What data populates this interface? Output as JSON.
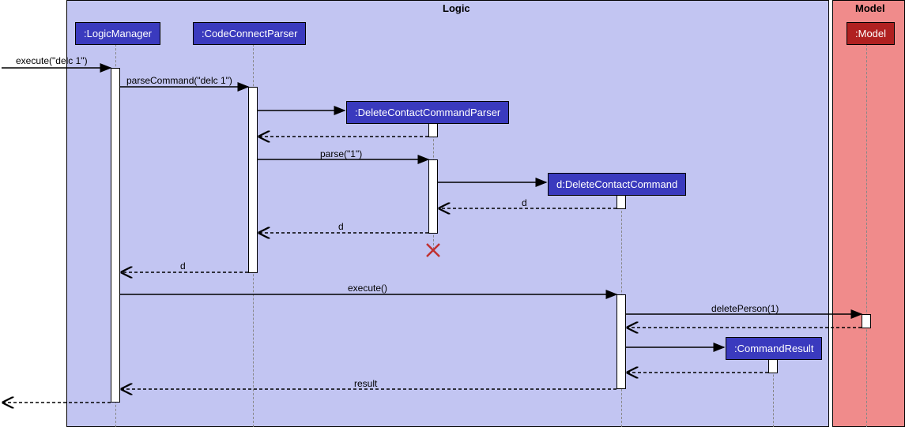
{
  "frames": {
    "logic": "Logic",
    "model": "Model"
  },
  "participants": {
    "logicManager": ":LogicManager",
    "codeConnectParser": ":CodeConnectParser",
    "deleteContactCommandParser": ":DeleteContactCommandParser",
    "deleteContactCommand": "d:DeleteContactCommand",
    "model": ":Model",
    "commandResult": ":CommandResult"
  },
  "messages": {
    "execute1": "execute(\"delc 1\")",
    "parseCommand": "parseCommand(\"delc 1\")",
    "parse": "parse(\"1\")",
    "d1": "d",
    "d2": "d",
    "d3": "d",
    "execute2": "execute()",
    "deletePerson": "deletePerson(1)",
    "result": "result"
  },
  "chart_data": {
    "type": "sequence-diagram",
    "frames": [
      {
        "name": "Logic",
        "participants": [
          ":LogicManager",
          ":CodeConnectParser",
          ":DeleteContactCommandParser",
          "d:DeleteContactCommand",
          ":CommandResult"
        ]
      },
      {
        "name": "Model",
        "participants": [
          ":Model"
        ]
      }
    ],
    "interactions": [
      {
        "from": "external",
        "to": ":LogicManager",
        "message": "execute(\"delc 1\")",
        "type": "sync"
      },
      {
        "from": ":LogicManager",
        "to": ":CodeConnectParser",
        "message": "parseCommand(\"delc 1\")",
        "type": "sync"
      },
      {
        "from": ":CodeConnectParser",
        "to": ":DeleteContactCommandParser",
        "message": "create",
        "type": "create"
      },
      {
        "from": ":DeleteContactCommandParser",
        "to": ":CodeConnectParser",
        "message": "",
        "type": "return"
      },
      {
        "from": ":CodeConnectParser",
        "to": ":DeleteContactCommandParser",
        "message": "parse(\"1\")",
        "type": "sync"
      },
      {
        "from": ":DeleteContactCommandParser",
        "to": "d:DeleteContactCommand",
        "message": "create",
        "type": "create"
      },
      {
        "from": "d:DeleteContactCommand",
        "to": ":DeleteContactCommandParser",
        "message": "d",
        "type": "return"
      },
      {
        "from": ":DeleteContactCommandParser",
        "to": ":CodeConnectParser",
        "message": "d",
        "type": "return"
      },
      {
        "from": ":DeleteContactCommandParser",
        "to": "destroy",
        "message": "",
        "type": "destroy"
      },
      {
        "from": ":CodeConnectParser",
        "to": ":LogicManager",
        "message": "d",
        "type": "return"
      },
      {
        "from": ":LogicManager",
        "to": "d:DeleteContactCommand",
        "message": "execute()",
        "type": "sync"
      },
      {
        "from": "d:DeleteContactCommand",
        "to": ":Model",
        "message": "deletePerson(1)",
        "type": "sync"
      },
      {
        "from": ":Model",
        "to": "d:DeleteContactCommand",
        "message": "",
        "type": "return"
      },
      {
        "from": "d:DeleteContactCommand",
        "to": ":CommandResult",
        "message": "create",
        "type": "create"
      },
      {
        "from": ":CommandResult",
        "to": "d:DeleteContactCommand",
        "message": "",
        "type": "return"
      },
      {
        "from": "d:DeleteContactCommand",
        "to": ":LogicManager",
        "message": "result",
        "type": "return"
      },
      {
        "from": ":LogicManager",
        "to": "external",
        "message": "",
        "type": "return"
      }
    ]
  }
}
